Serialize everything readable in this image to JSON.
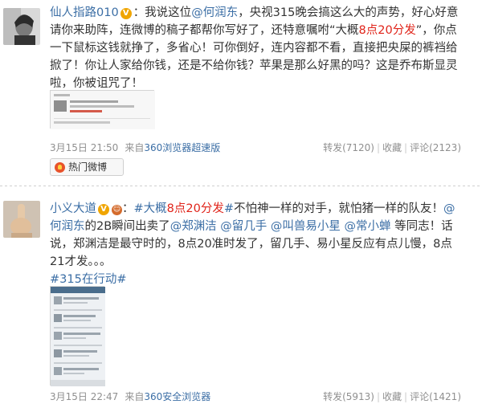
{
  "posts": [
    {
      "author": "仙人指路010",
      "badge": "V",
      "text_segments": [
        {
          "text": "：我说这位",
          "style": "plain"
        },
        {
          "text": "@何润东",
          "style": "link"
        },
        {
          "text": "，央视315晚会搞这么大的声势，好心好意请你来助阵，连微博的稿子都帮你写好了，还特意嘱咐“大概",
          "style": "plain"
        },
        {
          "text": "8点20分发",
          "style": "red"
        },
        {
          "text": "”，你点一下鼠标这钱就挣了，多省心！可你倒好，连内容都不看，直接把央屎的裤裆给掀了！你让人家给你钱，还是不给你钱？苹果是那么好黑的吗？这是乔布斯显灵啦，你被诅咒了！",
          "style": "plain"
        }
      ],
      "time": "3月15日 21:50",
      "from_prefix": "来自",
      "source": "360浏览器超速版",
      "actions": {
        "repost": "转发(7120)",
        "favorite": "收藏",
        "comment": "评论(2123)"
      },
      "hot_button": "热门微博"
    },
    {
      "author": "小义大道",
      "badge": "V",
      "text_segments": [
        {
          "text": "：",
          "style": "plain"
        },
        {
          "text": "#大概",
          "style": "link"
        },
        {
          "text": "8点20分发",
          "style": "red"
        },
        {
          "text": "#",
          "style": "link"
        },
        {
          "text": "不怕神一样的对手，就怕猪一样的队友！",
          "style": "plain"
        },
        {
          "text": "@何润东",
          "style": "link"
        },
        {
          "text": "的2B瞬间出卖了",
          "style": "plain"
        },
        {
          "text": "@郑渊洁",
          "style": "link"
        },
        {
          "text": " ",
          "style": "plain"
        },
        {
          "text": "@留几手",
          "style": "link"
        },
        {
          "text": " ",
          "style": "plain"
        },
        {
          "text": "@叫兽易小星",
          "style": "link"
        },
        {
          "text": " ",
          "style": "plain"
        },
        {
          "text": "@常小蝉",
          "style": "link"
        },
        {
          "text": " 等同志！话说，郑渊洁是最守时的，8点20准时发了，留几手、易小星反应有点儿慢，8点21才发。。。",
          "style": "plain"
        },
        {
          "text": "#315在行动#",
          "style": "link"
        }
      ],
      "time": "3月15日 22:47",
      "from_prefix": "来自",
      "source": "360安全浏览器",
      "actions": {
        "repost": "转发(5913)",
        "favorite": "收藏",
        "comment": "评论(1421)"
      }
    }
  ],
  "colors": {
    "link": "#3b6ea5",
    "highlight": "#e0241a",
    "meta": "#8f8f8f"
  }
}
